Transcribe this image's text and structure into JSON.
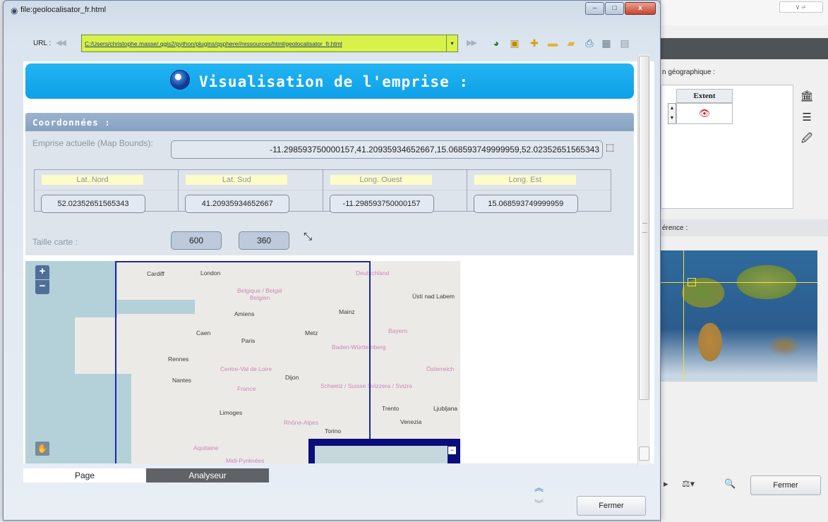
{
  "window": {
    "title": "file:geolocalisator_fr.html",
    "buttons": {
      "minimize": "–",
      "maximize": "□",
      "close": "x"
    }
  },
  "urlbar": {
    "label": "URL :",
    "back": "◀◀",
    "value": "C:/Users/christophe.masse/.qgis2/python/plugins/qsphere//ressources/html/geolocalisator_fr.html",
    "dropdown": "▾",
    "forward": "▶▶",
    "toolbar_icons": [
      "eye-icon",
      "bookmark-icon",
      "pin-icon",
      "folder-icon",
      "folder-eye-icon",
      "print-icon",
      "xml-icon",
      "save-icon"
    ]
  },
  "banner": {
    "title": "Visualisation de l'emprise :"
  },
  "coords": {
    "header": "Coordonnées :",
    "emprise_label": "Emprise actuelle (Map Bounds):",
    "emprise_value": "-11.298593750000157,41.20935934652667,15.068593749999959,52.02352651565343",
    "lat_nord_label": "Lat. Nord",
    "lat_nord": "52.02352651565343",
    "lat_sud_label": "Lat. Sud",
    "lat_sud": "41.20935934652667",
    "long_ouest_label": "Long. Ouest",
    "long_ouest": "-11.298593750000157",
    "long_est_label": "Long. Est",
    "long_est": "15.068593749999959",
    "taille_label": "Taille carte :",
    "width": "600",
    "height": "360"
  },
  "map": {
    "zoom_in": "+",
    "zoom_out": "−",
    "overview_toggle": "−",
    "labels": {
      "cardiff": "Cardiff",
      "london": "London",
      "deutschland": "Deutschland",
      "belgique": "Belgique / België",
      "belgien": "Belgien",
      "usti": "Ústí nad Labem",
      "amiens": "Amiens",
      "mainz": "Mainz",
      "caen": "Caen",
      "paris": "Paris",
      "metz": "Metz",
      "bayern": "Bayern",
      "baden": "Baden-Württemberg",
      "rennes": "Rennes",
      "centre": "Centre-Val de Loire",
      "osterreich": "Österreich",
      "nantes": "Nantes",
      "dijon": "Dijon",
      "france": "France",
      "schweiz": "Schweiz / Suisse Svizzera / Svizra",
      "limoges": "Limoges",
      "trento": "Trento",
      "ljubljana": "Ljubljana",
      "rhone": "Rhône-Alpes",
      "venezia": "Venezia",
      "torino": "Torino",
      "aquitaine": "Aquitaine",
      "midi": "Midi-Pyrénées"
    }
  },
  "tabs": {
    "page": "Page",
    "analyseur": "Analyseur"
  },
  "footer": {
    "fermer": "Fermer",
    "chev_up": "︽",
    "chev_down": "︾"
  },
  "background_app": {
    "geo_label": "n géographique :",
    "extent_header": "Extent",
    "ref_label": "érence :",
    "fermer": "Fermer",
    "top_ctrl": "v  ⩫"
  }
}
